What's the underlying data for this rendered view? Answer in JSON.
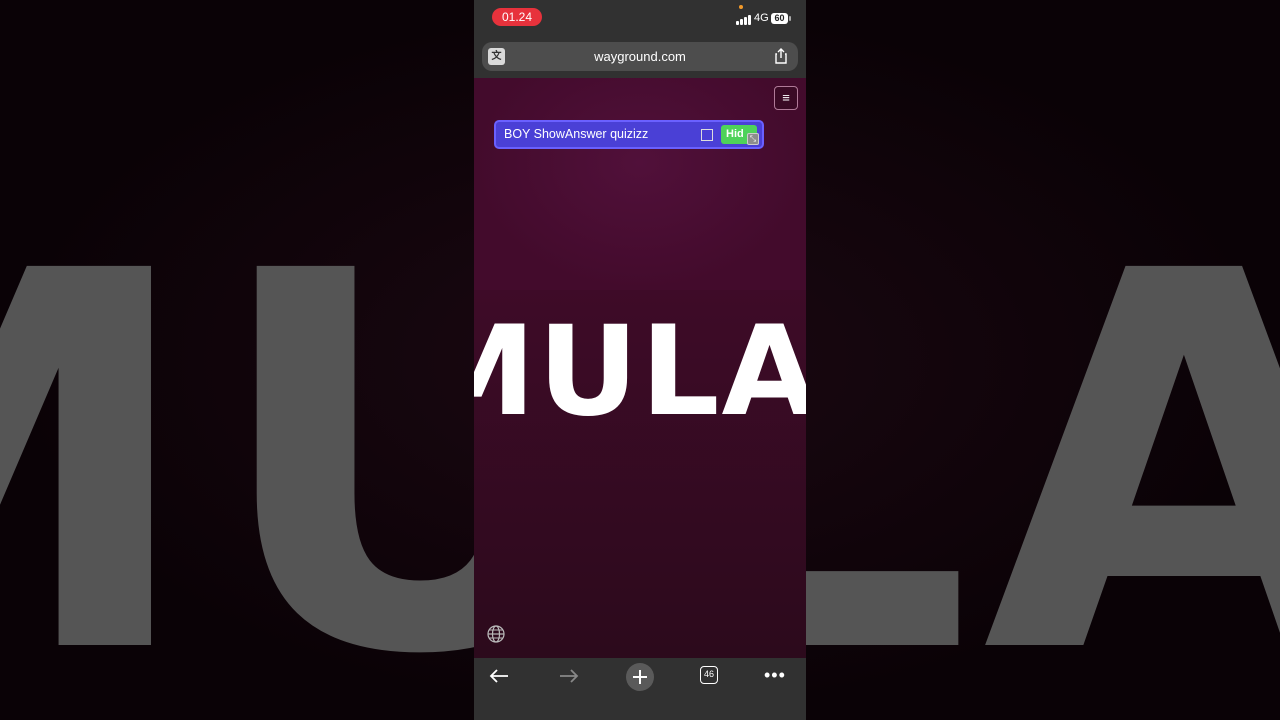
{
  "background": {
    "blurred_word": "MULAI"
  },
  "status_bar": {
    "time": "01.24",
    "network": "4G",
    "battery": "60"
  },
  "browser": {
    "url": "wayground.com"
  },
  "quiz_panel": {
    "title": "BOY ShowAnswer quizizz",
    "hide_label": "Hid"
  },
  "page": {
    "start_word": "MULAI"
  },
  "toolbar": {
    "tab_count": "46"
  },
  "colors": {
    "time_pill": "#e7323c",
    "panel": "#4a40d6",
    "hide_button": "#4ed25a",
    "page_bg": "#3d0b27"
  }
}
